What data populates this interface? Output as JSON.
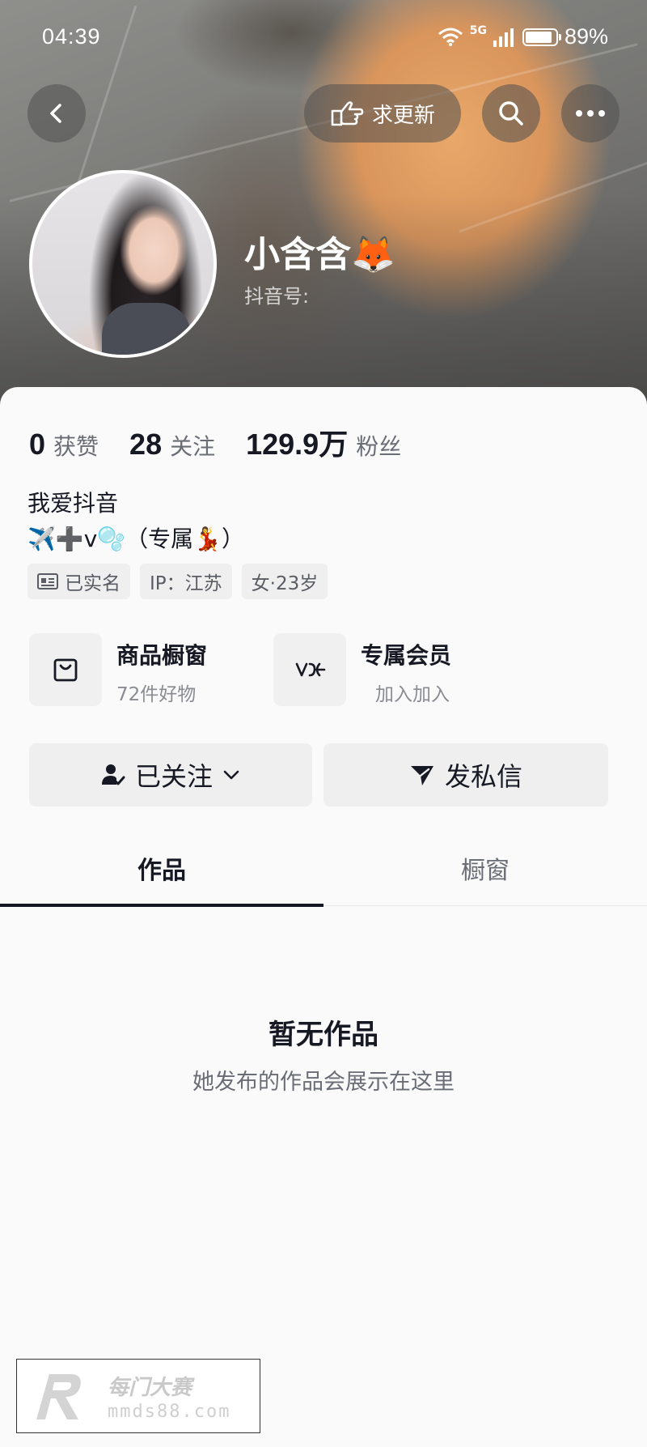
{
  "status_bar": {
    "time": "04:39",
    "network": "5G",
    "battery_percent": 89,
    "battery_text": "89%"
  },
  "top_nav": {
    "request_update_label": "求更新"
  },
  "profile": {
    "username": "小含含🦊",
    "douyin_id_label": "抖音号:"
  },
  "stats": [
    {
      "value": "0",
      "label": "获赞"
    },
    {
      "value": "28",
      "label": "关注"
    },
    {
      "value": "129.9万",
      "label": "粉丝"
    }
  ],
  "bio": {
    "line1": "我爱抖音",
    "line2": "✈️➕v🫧（专属💃）"
  },
  "tags": {
    "verified": "已实名",
    "ip": "IP：江苏",
    "gender_age": "女·23岁"
  },
  "features": {
    "shop_title": "商品橱窗",
    "shop_sub": "72件好物",
    "member_title": "专属会员",
    "member_sub": "加入加入"
  },
  "actions": {
    "follow_label": "已关注",
    "message_label": "发私信"
  },
  "tabs": [
    "作品",
    "橱窗"
  ],
  "empty_state": {
    "title": "暂无作品",
    "subtitle": "她发布的作品会展示在这里"
  },
  "watermark": {
    "text": "每门大赛",
    "url": "mmds88.com"
  },
  "colors": {
    "text_primary": "#161823",
    "text_secondary": "#6b6d76",
    "panel_bg": "#fafafa",
    "button_bg": "#efefef"
  }
}
